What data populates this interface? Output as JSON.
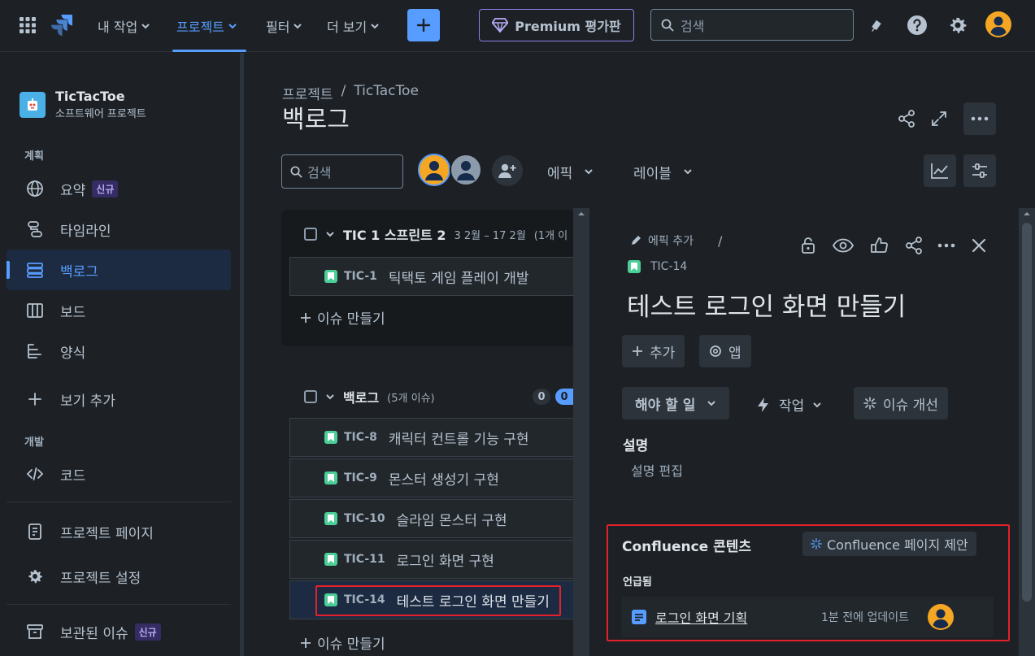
{
  "colors": {
    "accent": "#579dff",
    "background": "#1d2125",
    "story": "#4bce97",
    "highlight": "#e5202a",
    "premium": "#8f7ee7",
    "avatar_orange": "#f5a623"
  },
  "topnav": {
    "menu_items": [
      "내 작업",
      "프로젝트",
      "필터",
      "더 보기"
    ],
    "premium_label": "Premium 평가판",
    "search_placeholder": "검색",
    "icons": [
      "app-switcher-icon",
      "jira-logo-icon",
      "plus-icon",
      "diamond-icon",
      "search-icon",
      "notification-icon",
      "help-icon",
      "settings-icon",
      "user-avatar-icon"
    ]
  },
  "sidebar": {
    "project_name": "TicTacToe",
    "project_type": "소프트웨어 프로젝트",
    "section_planning": "계획",
    "items": [
      {
        "label": "요약",
        "badge": "신규",
        "icon": "globe-icon"
      },
      {
        "label": "타임라인",
        "icon": "timeline-icon"
      },
      {
        "label": "백로그",
        "icon": "backlog-icon",
        "active": true
      },
      {
        "label": "보드",
        "icon": "board-icon"
      },
      {
        "label": "양식",
        "icon": "forms-icon"
      },
      {
        "label": "보기 추가",
        "icon": "plus-icon"
      }
    ],
    "section_dev": "개발",
    "dev_items": [
      {
        "label": "코드",
        "icon": "code-icon"
      }
    ],
    "bottom_items": [
      {
        "label": "프로젝트 페이지",
        "icon": "page-icon"
      },
      {
        "label": "프로젝트 설정",
        "icon": "settings-icon"
      },
      {
        "label": "보관된 이슈",
        "badge": "신규",
        "icon": "archive-icon"
      }
    ]
  },
  "main": {
    "breadcrumb": [
      "프로젝트",
      "/",
      "TicTacToe"
    ],
    "title": "백로그",
    "search_placeholder": "검색",
    "filters": [
      "에픽",
      "레이블"
    ],
    "sprint": {
      "title": "TIC 1 스프린트 2",
      "dates": "3 2월 – 17 2월",
      "count": "(1개 이",
      "issues": [
        {
          "key": "TIC-1",
          "summary": "틱택토 게임 플레이 개발"
        }
      ],
      "create_label": "이슈 만들기"
    },
    "backlog": {
      "title": "백로그",
      "count": "(5개 이슈)",
      "pill_a": "0",
      "pill_b": "0",
      "issues": [
        {
          "key": "TIC-8",
          "summary": "캐릭터 컨트롤 기능 구현"
        },
        {
          "key": "TIC-9",
          "summary": "몬스터 생성기 구현"
        },
        {
          "key": "TIC-10",
          "summary": "슬라임 몬스터 구현"
        },
        {
          "key": "TIC-11",
          "summary": "로그인 화면 구현"
        },
        {
          "key": "TIC-14",
          "summary": "테스트 로그인 화면 만들기",
          "selected": true
        }
      ],
      "create_label": "이슈 만들기"
    }
  },
  "detail": {
    "add_epic": "에픽 추가",
    "separator": "/",
    "key": "TIC-14",
    "title": "테스트 로그인 화면 만들기",
    "add_label": "추가",
    "apps_label": "앱",
    "status": "해야 할 일",
    "action_label": "작업",
    "improve_label": "이슈 개선",
    "description_title": "설명",
    "description_placeholder": "설명 편집",
    "confluence": {
      "title": "Confluence 콘텐츠",
      "suggest_label": "Confluence 페이지 제안",
      "mentioned_label": "언급됨",
      "page_title": "로그인 화면 기획",
      "updated": "1분 전에 업데이트"
    }
  }
}
